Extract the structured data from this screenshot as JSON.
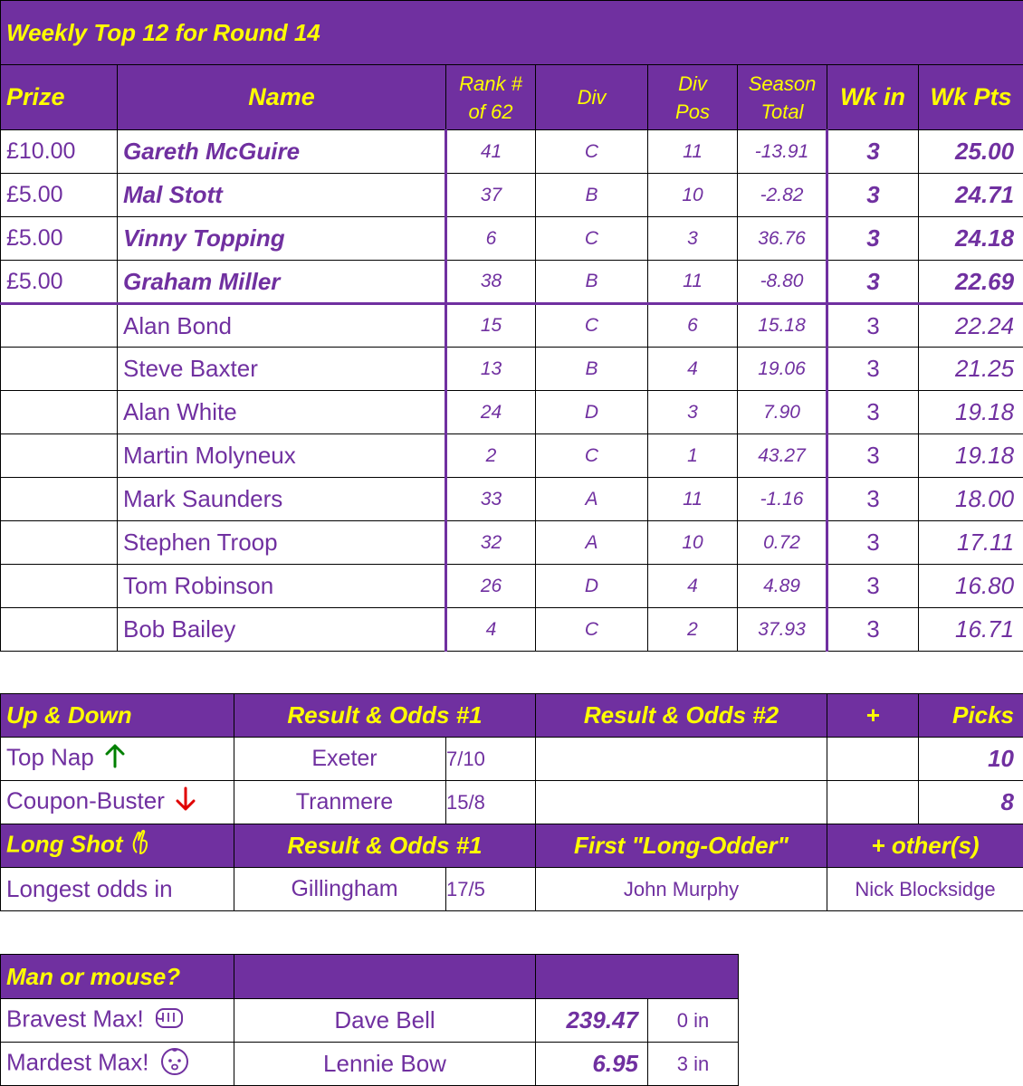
{
  "title": "Weekly Top 12 for Round 14",
  "columns": {
    "prize": "Prize",
    "name": "Name",
    "rank_line1": "Rank #",
    "rank_line2": "of 62",
    "div": "Div",
    "divpos_line1": "Div",
    "divpos_line2": "Pos",
    "season_line1": "Season",
    "season_line2": "Total",
    "wk_in": "Wk in",
    "wk_pts": "Wk Pts"
  },
  "rows": [
    {
      "prize": "£10.00",
      "name": "Gareth McGuire",
      "rank": "41",
      "div": "C",
      "divpos": "11",
      "season": "-13.91",
      "wkin": "3",
      "wkpts": "25.00"
    },
    {
      "prize": "£5.00",
      "name": "Mal Stott",
      "rank": "37",
      "div": "B",
      "divpos": "10",
      "season": "-2.82",
      "wkin": "3",
      "wkpts": "24.71"
    },
    {
      "prize": "£5.00",
      "name": "Vinny Topping",
      "rank": "6",
      "div": "C",
      "divpos": "3",
      "season": "36.76",
      "wkin": "3",
      "wkpts": "24.18"
    },
    {
      "prize": "£5.00",
      "name": "Graham Miller",
      "rank": "38",
      "div": "B",
      "divpos": "11",
      "season": "-8.80",
      "wkin": "3",
      "wkpts": "22.69"
    },
    {
      "prize": "",
      "name": "Alan Bond",
      "rank": "15",
      "div": "C",
      "divpos": "6",
      "season": "15.18",
      "wkin": "3",
      "wkpts": "22.24"
    },
    {
      "prize": "",
      "name": "Steve Baxter",
      "rank": "13",
      "div": "B",
      "divpos": "4",
      "season": "19.06",
      "wkin": "3",
      "wkpts": "21.25"
    },
    {
      "prize": "",
      "name": "Alan White",
      "rank": "24",
      "div": "D",
      "divpos": "3",
      "season": "7.90",
      "wkin": "3",
      "wkpts": "19.18"
    },
    {
      "prize": "",
      "name": "Martin Molyneux",
      "rank": "2",
      "div": "C",
      "divpos": "1",
      "season": "43.27",
      "wkin": "3",
      "wkpts": "19.18"
    },
    {
      "prize": "",
      "name": "Mark Saunders",
      "rank": "33",
      "div": "A",
      "divpos": "11",
      "season": "-1.16",
      "wkin": "3",
      "wkpts": "18.00"
    },
    {
      "prize": "",
      "name": "Stephen Troop",
      "rank": "32",
      "div": "A",
      "divpos": "10",
      "season": "0.72",
      "wkin": "3",
      "wkpts": "17.11"
    },
    {
      "prize": "",
      "name": "Tom Robinson",
      "rank": "26",
      "div": "D",
      "divpos": "4",
      "season": "4.89",
      "wkin": "3",
      "wkpts": "16.80"
    },
    {
      "prize": "",
      "name": "Bob Bailey",
      "rank": "4",
      "div": "C",
      "divpos": "2",
      "season": "37.93",
      "wkin": "3",
      "wkpts": "16.71"
    }
  ],
  "updown": {
    "header": "Up & Down",
    "result1_header": "Result & Odds #1",
    "result2_header": "Result & Odds #2",
    "plus_header": "+",
    "picks_header": "Picks",
    "rows": [
      {
        "label": "Top Nap",
        "icon": "arrow-up-icon",
        "team": "Exeter",
        "odds": "7/10",
        "picks": "10"
      },
      {
        "label": "Coupon-Buster",
        "icon": "arrow-down-icon",
        "team": "Tranmere",
        "odds": "15/8",
        "picks": "8"
      }
    ]
  },
  "longshot": {
    "header": "Long Shot",
    "result1_header": "Result & Odds #1",
    "first_header": "First \"Long-Odder\"",
    "others_header": "+ other(s)",
    "label": "Longest odds in",
    "team": "Gillingham",
    "odds": "17/5",
    "first": "John Murphy",
    "others": "Nick Blocksidge"
  },
  "manmouse": {
    "header": "Man or mouse?",
    "rows": [
      {
        "label": "Bravest Max!",
        "icon": "fist-icon",
        "name": "Dave Bell",
        "value": "239.47",
        "in": "0 in"
      },
      {
        "label": "Mardest Max!",
        "icon": "baby-face-icon",
        "name": "Lennie Bow",
        "value": "6.95",
        "in": "3 in"
      }
    ]
  },
  "colors": {
    "header_bg": "#7030a0",
    "header_text": "#ffff00",
    "body_text": "#7030a0",
    "up_arrow": "#008000",
    "down_arrow": "#e00000"
  }
}
